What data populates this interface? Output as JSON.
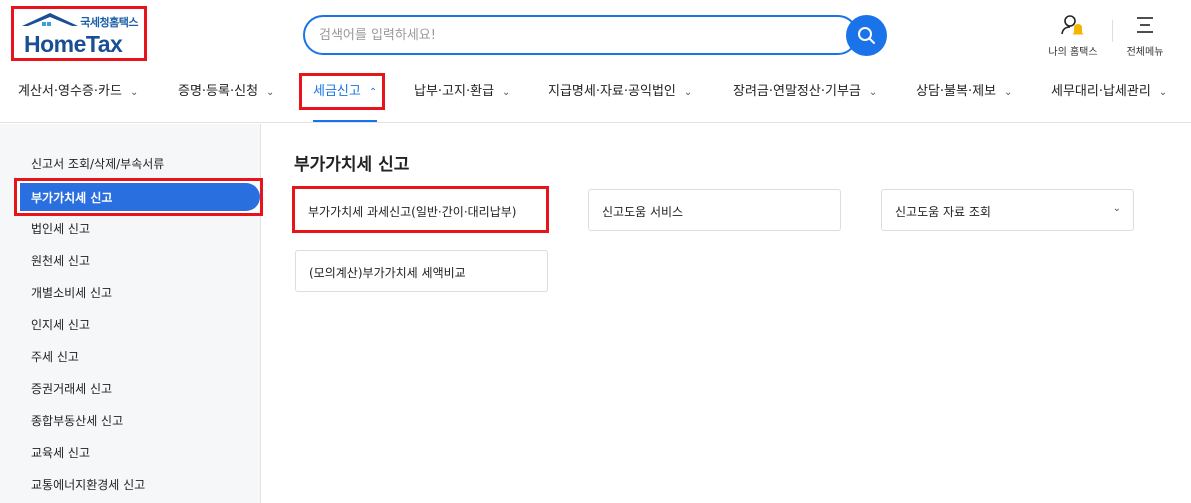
{
  "logo": {
    "sub": "국세청홈택스",
    "main": "HomeTax"
  },
  "search": {
    "placeholder": "검색어를 입력하세요!"
  },
  "utility": {
    "my_home": "나의 홈택스",
    "all_menu": "전체메뉴"
  },
  "gnb": [
    {
      "label": "계산서·영수증·카드"
    },
    {
      "label": "증명·등록·신청"
    },
    {
      "label": "세금신고"
    },
    {
      "label": "납부·고지·환급"
    },
    {
      "label": "지급명세·자료·공익법인"
    },
    {
      "label": "장려금·연말정산·기부금"
    },
    {
      "label": "상담·불복·제보"
    },
    {
      "label": "세무대리·납세관리"
    }
  ],
  "sidebar": {
    "items": [
      {
        "label": "신고서 조회/삭제/부속서류"
      },
      {
        "label": "부가가치세 신고"
      },
      {
        "label": "법인세 신고"
      },
      {
        "label": "원천세 신고"
      },
      {
        "label": "개별소비세 신고"
      },
      {
        "label": "인지세 신고"
      },
      {
        "label": "주세 신고"
      },
      {
        "label": "증권거래세 신고"
      },
      {
        "label": "종합부동산세 신고"
      },
      {
        "label": "교육세 신고"
      },
      {
        "label": "교통에너지환경세 신고"
      }
    ]
  },
  "main": {
    "title": "부가가치세 신고",
    "cards": [
      {
        "label": "부가가치세 과세신고(일반·간이·대리납부)"
      },
      {
        "label": "신고도움 서비스"
      },
      {
        "label": "신고도움 자료 조회"
      },
      {
        "label": "(모의계산)부가가치세 세액비교"
      }
    ]
  },
  "colors": {
    "accent": "#1a73e8",
    "highlight": "#e8141c",
    "sidebar_active": "#2a6fe0"
  }
}
